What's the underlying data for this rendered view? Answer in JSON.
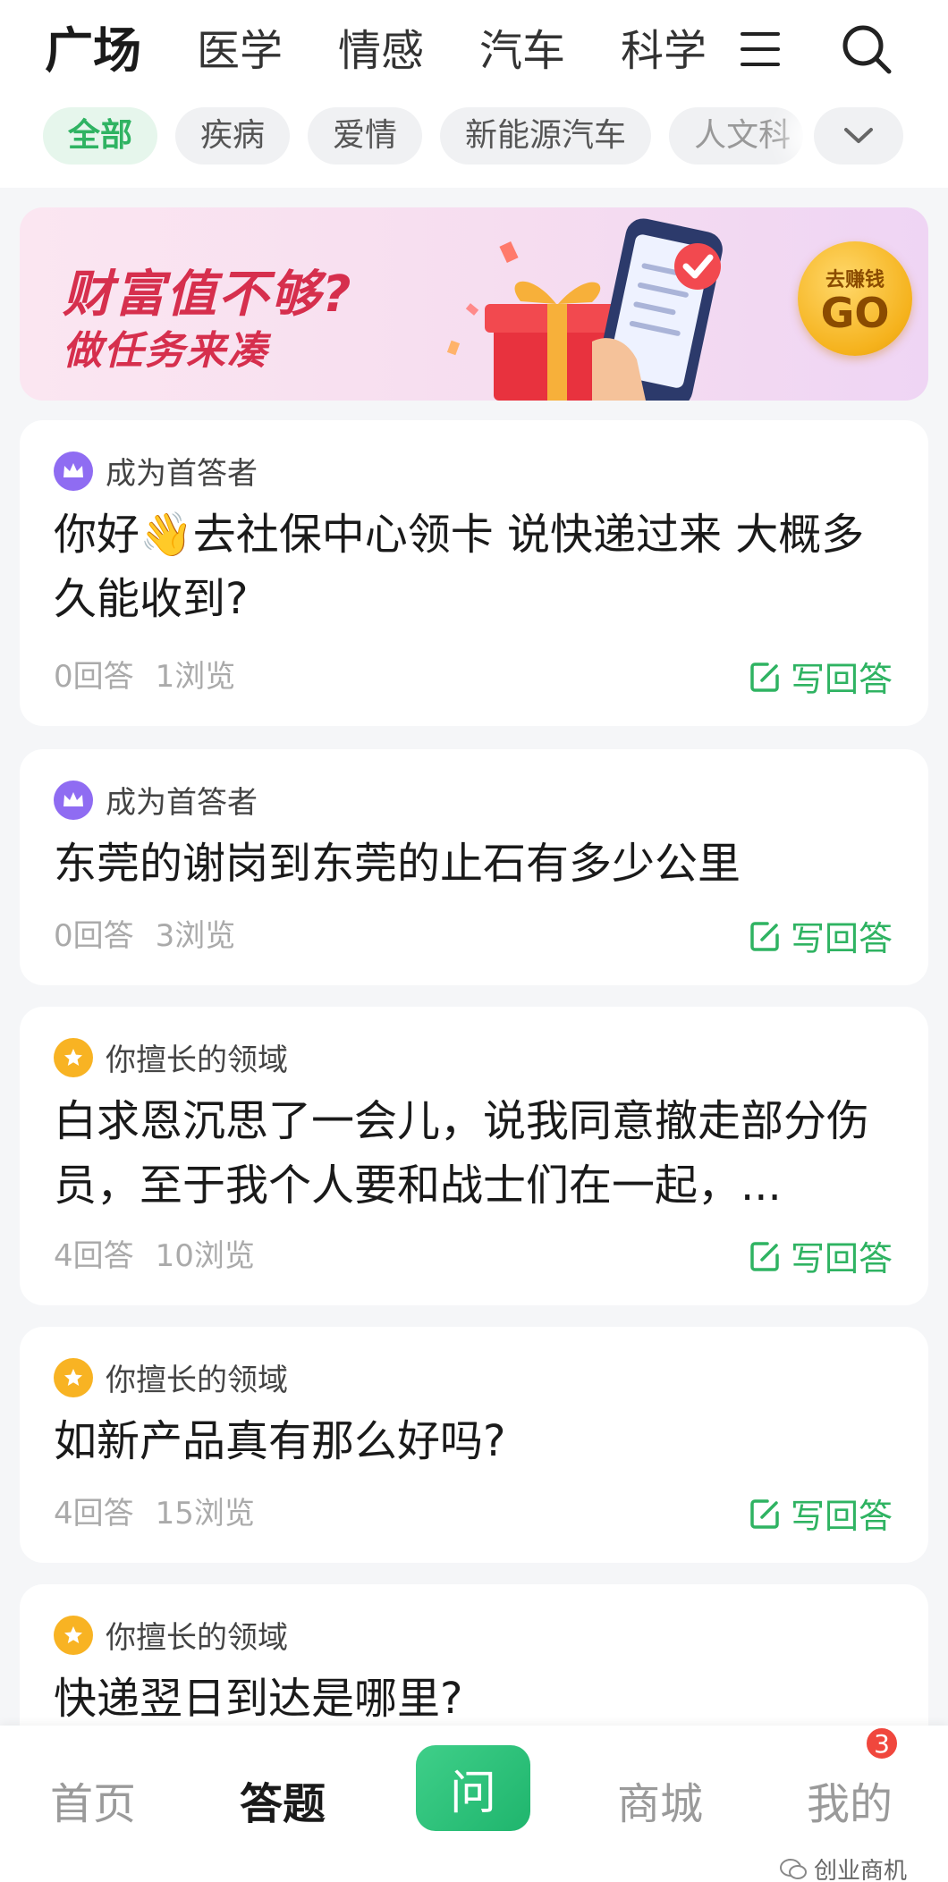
{
  "colors": {
    "accent": "#2fb362",
    "banner_text": "#d62f4d",
    "badge": "#f0473d"
  },
  "header": {
    "tabs": [
      "广场",
      "医学",
      "情感",
      "汽车",
      "科学"
    ],
    "menu_icon": "menu-icon",
    "search_icon": "search-icon"
  },
  "chips": [
    "全部",
    "疾病",
    "爱情",
    "新能源汽车",
    "人文科"
  ],
  "banner": {
    "title": "财富值不够?",
    "subtitle": "做任务来凑",
    "go_small": "去赚钱",
    "go_big": "GO"
  },
  "cards": [
    {
      "tag": "成为首答者",
      "tag_icon": "crown-icon",
      "title": "你好👋去社保中心领卡 说快递过来 大概多久能收到?",
      "answers": "0回答",
      "views": "1浏览",
      "action": "写回答"
    },
    {
      "tag": "成为首答者",
      "tag_icon": "crown-icon",
      "title": "东莞的谢岗到东莞的止石有多少公里",
      "answers": "0回答",
      "views": "3浏览",
      "action": "写回答"
    },
    {
      "tag": "你擅长的领域",
      "tag_icon": "star-icon",
      "title": "白求恩沉思了一会儿，说我同意撤走部分伤员，至于我个人要和战士们在一起，...",
      "answers": "4回答",
      "views": "10浏览",
      "action": "写回答"
    },
    {
      "tag": "你擅长的领域",
      "tag_icon": "star-icon",
      "title": "如新产品真有那么好吗?",
      "answers": "4回答",
      "views": "15浏览",
      "action": "写回答"
    },
    {
      "tag": "你擅长的领域",
      "tag_icon": "star-icon",
      "title": "快递翌日到达是哪里?"
    }
  ],
  "bottom_nav": {
    "home": "首页",
    "answer": "答题",
    "ask": "问",
    "mall": "商城",
    "mine": "我的",
    "badge": "3"
  },
  "watermark": "创业商机"
}
